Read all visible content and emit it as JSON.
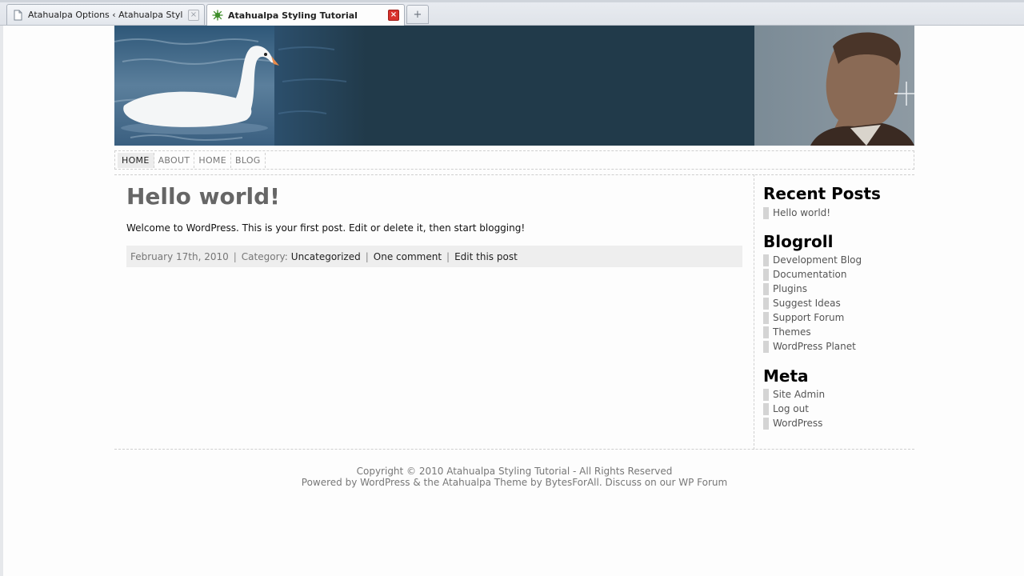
{
  "browser": {
    "tabs": [
      {
        "label": "Atahualpa Options ‹ Atahualpa Styling ...",
        "active": false,
        "icon": "page-icon"
      },
      {
        "label": "Atahualpa Styling Tutorial",
        "active": true,
        "icon": "wordpress-favicon-icon"
      }
    ],
    "close_glyph": "×",
    "new_tab_glyph": "+"
  },
  "colors": {
    "header_bg": "#213a4a",
    "tab_close_active": "#d8312c",
    "sidebar_bullet": "#d4d4d4",
    "post_footer_bg": "#eeeeee"
  },
  "nav": {
    "items": [
      "HOME",
      "ABOUT",
      "HOME",
      "BLOG"
    ]
  },
  "post": {
    "title": "Hello world!",
    "body": "Welcome to WordPress. This is your first post. Edit or delete it, then start blogging!",
    "date": "February 17th, 2010",
    "category_label": "Category:",
    "category": "Uncategorized",
    "comments": "One comment",
    "edit": "Edit this post",
    "separator": "|"
  },
  "sidebar": {
    "recent_posts": {
      "title": "Recent Posts",
      "items": [
        "Hello world!"
      ]
    },
    "blogroll": {
      "title": "Blogroll",
      "items": [
        "Development Blog",
        "Documentation",
        "Plugins",
        "Suggest Ideas",
        "Support Forum",
        "Themes",
        "WordPress Planet"
      ]
    },
    "meta": {
      "title": "Meta",
      "items": [
        "Site Admin",
        "Log out",
        "WordPress"
      ]
    }
  },
  "footer": {
    "line1": "Copyright © 2010 Atahualpa Styling Tutorial - All Rights Reserved",
    "line2": "Powered by WordPress & the Atahualpa Theme by BytesForAll. Discuss on our WP Forum"
  }
}
